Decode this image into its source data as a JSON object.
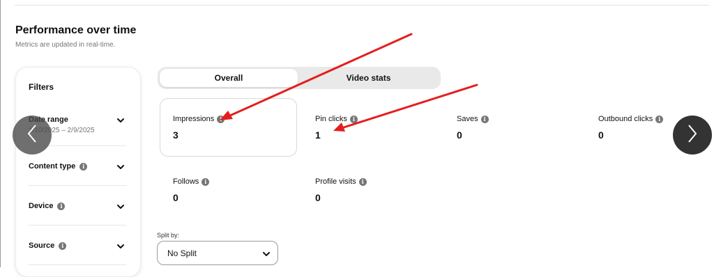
{
  "performance": {
    "title": "Performance over time",
    "subtitle": "Metrics are updated in real-time."
  },
  "filters": {
    "title": "Filters",
    "items": [
      {
        "label": "Date range",
        "value": "1/10/2025 – 2/9/2025",
        "has_info": false
      },
      {
        "label": "Content type",
        "has_info": true
      },
      {
        "label": "Device",
        "has_info": true
      },
      {
        "label": "Source",
        "has_info": true
      }
    ]
  },
  "tabs": [
    {
      "label": "Overall",
      "selected": true
    },
    {
      "label": "Video stats",
      "selected": false
    }
  ],
  "metrics": [
    {
      "label": "Impressions",
      "value": "3",
      "highlighted": true
    },
    {
      "label": "Pin clicks",
      "value": "1"
    },
    {
      "label": "Saves",
      "value": "0"
    },
    {
      "label": "Outbound clicks",
      "value": "0"
    },
    {
      "label": "Follows",
      "value": "0"
    },
    {
      "label": "Profile visits",
      "value": "0"
    }
  ],
  "split_by": {
    "label": "Split by:",
    "value": "No Split"
  },
  "icons": {
    "info": "info-icon",
    "chevron": "chevron-down-icon",
    "prev": "chevron-left-icon",
    "next": "chevron-right-icon"
  },
  "colors": {
    "annotation_arrow": "#e41e1e",
    "carousel_next": "#333333"
  }
}
